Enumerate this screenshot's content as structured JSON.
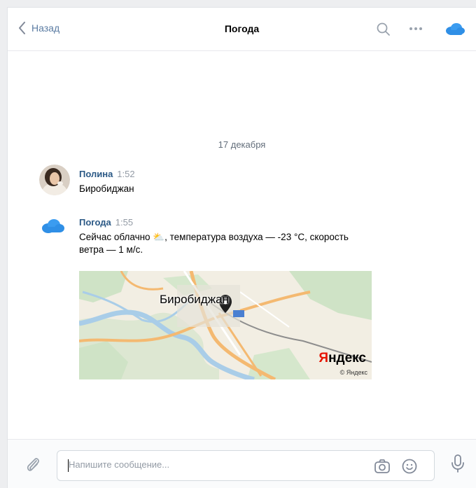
{
  "header": {
    "back_label": "Назад",
    "title": "Погода",
    "icons": [
      "chevron-left-icon",
      "search-icon",
      "more-icon",
      "cloud-avatar-icon"
    ]
  },
  "chat": {
    "date_divider": "17 декабря",
    "messages": [
      {
        "author": "Полина",
        "time": "1:52",
        "text": "Биробиджан"
      },
      {
        "author": "Погода",
        "time": "1:55",
        "text_line1": "Сейчас облачно ⛅, температура воздуха — -23 °C, скорость",
        "text_line2": "ветра — 1 м/с."
      }
    ],
    "map": {
      "city_label": "Биробиджан",
      "brand": "Яндекс",
      "copyright": "© Яндекс"
    }
  },
  "composer": {
    "placeholder": "Напишите сообщение...",
    "icons": [
      "attach-icon",
      "camera-icon",
      "emoji-icon",
      "microphone-icon"
    ]
  },
  "colors": {
    "accent": "#2a5885",
    "link": "#5b7ca3",
    "cloud": "#2f8fe6",
    "yandex_red": "#e61400"
  }
}
